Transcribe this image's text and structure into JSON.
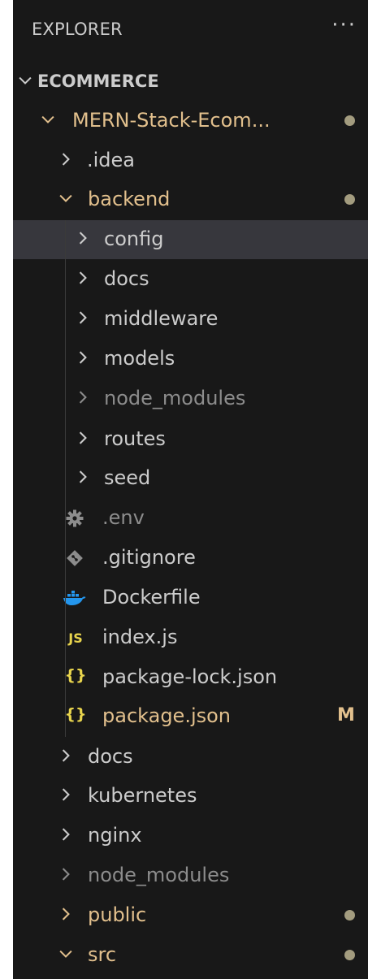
{
  "explorer": {
    "title": "EXPLORER",
    "more_label": "···"
  },
  "root": {
    "label": "ECOMMERCE"
  },
  "rows": [
    {
      "label": "MERN-Stack-Ecom...",
      "status": "dot"
    },
    {
      "label": ".idea"
    },
    {
      "label": "backend",
      "status": "dot"
    },
    {
      "label": "config",
      "selected": true
    },
    {
      "label": "docs"
    },
    {
      "label": "middleware"
    },
    {
      "label": "models"
    },
    {
      "label": "node_modules",
      "ignored": true
    },
    {
      "label": "routes"
    },
    {
      "label": "seed"
    },
    {
      "label": ".env",
      "icon": "gear-icon",
      "ignored": true
    },
    {
      "label": ".gitignore",
      "icon": "git-icon"
    },
    {
      "label": "Dockerfile",
      "icon": "docker-icon"
    },
    {
      "label": "index.js",
      "icon": "js-icon",
      "icon_text": "JS"
    },
    {
      "label": "package-lock.json",
      "icon": "json-braces-icon",
      "icon_text": "{}"
    },
    {
      "label": "package.json",
      "icon": "json-braces-icon",
      "icon_text": "{}",
      "status": "M"
    },
    {
      "label": "docs"
    },
    {
      "label": "kubernetes"
    },
    {
      "label": "nginx"
    },
    {
      "label": "node_modules",
      "ignored": true
    },
    {
      "label": "public",
      "status": "dot"
    },
    {
      "label": "src",
      "status": "dot"
    }
  ],
  "badge_m": "M",
  "colors": {
    "background": "#181818",
    "selected_row": "#37373d",
    "folder_text": "#cccccc",
    "modified_text": "#e2c08d",
    "ignored_text": "#8c8c8c",
    "dot": "#a39c7f",
    "docker": "#2496ed",
    "json": "#e8d44d"
  }
}
